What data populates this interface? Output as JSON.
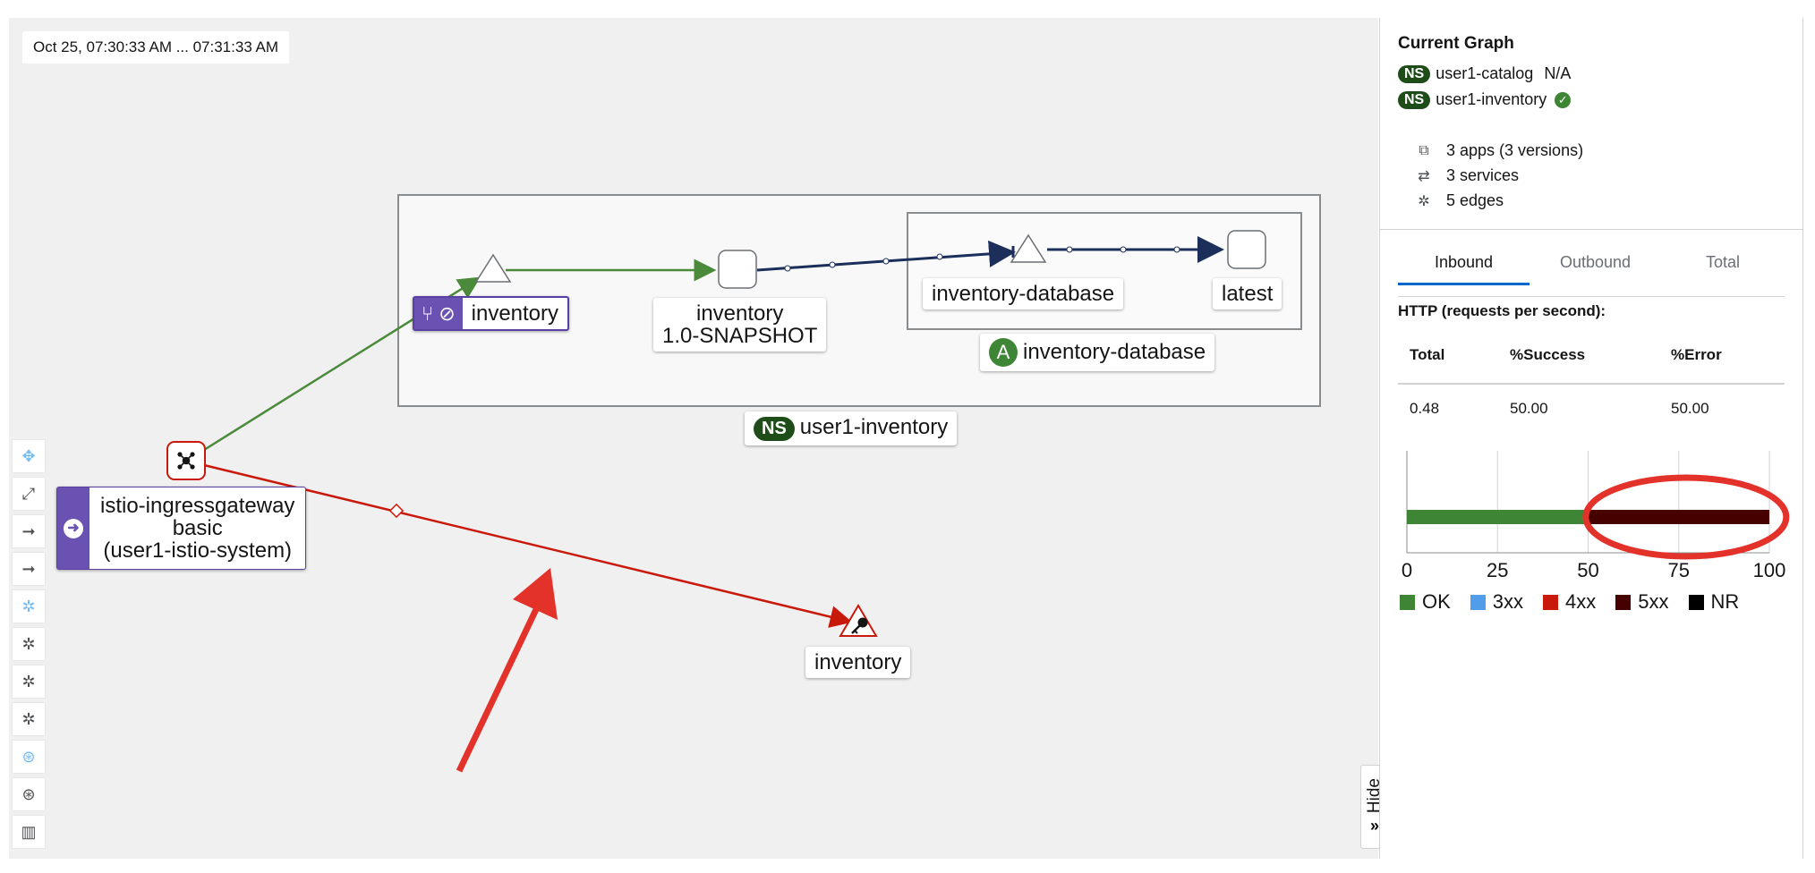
{
  "time_range": "Oct 25, 07:30:33 AM ... 07:31:33 AM",
  "graph": {
    "namespace_box_label": "user1-inventory",
    "ns_badge": "NS",
    "app_box_badge": "A",
    "app_box_label": "inventory-database",
    "nodes": {
      "inventory_app": "inventory",
      "inventory_workload_name": "inventory",
      "inventory_workload_version": "1.0-SNAPSHOT",
      "inventory_database": "inventory-database",
      "latest": "latest",
      "gateway_line1": "istio-ingressgateway",
      "gateway_line2": "basic",
      "gateway_line3": "(user1-istio-system)",
      "inventory_service": "inventory"
    },
    "edge_colors": {
      "healthy": "#4b8a3a",
      "error": "#c9190b",
      "tcp": "#1b2f5a"
    }
  },
  "toolbar": [
    "pan-icon",
    "fit-icon",
    "layout-arrow-icon",
    "layout-arrow-icon-2",
    "layout-cose-icon",
    "layout-dagre-icon",
    "layout-cola-icon",
    "layout-grid-icon",
    "namespace-layout-icon",
    "namespace-layout-icon-2",
    "legend-map-icon"
  ],
  "hide_label": "Hide",
  "panel": {
    "title": "Current Graph",
    "namespaces": [
      {
        "badge": "NS",
        "name": "user1-catalog",
        "status": "N/A"
      },
      {
        "badge": "NS",
        "name": "user1-inventory",
        "status": "healthy"
      }
    ],
    "stats": {
      "apps": "3 apps (3 versions)",
      "services": "3 services",
      "edges": "5 edges"
    },
    "tabs": [
      "Inbound",
      "Outbound",
      "Total"
    ],
    "active_tab": "Inbound",
    "http_title": "HTTP (requests per second):",
    "table": {
      "headers": [
        "Total",
        "%Success",
        "%Error"
      ],
      "values": [
        "0.48",
        "50.00",
        "50.00"
      ]
    }
  },
  "chart_data": {
    "type": "bar",
    "orientation": "horizontal",
    "stacked": true,
    "categories": [
      ""
    ],
    "series": [
      {
        "name": "OK",
        "values": [
          50
        ],
        "color": "#3e8635"
      },
      {
        "name": "3xx",
        "values": [
          0
        ],
        "color": "#519de9"
      },
      {
        "name": "4xx",
        "values": [
          0
        ],
        "color": "#c9190b"
      },
      {
        "name": "5xx",
        "values": [
          50
        ],
        "color": "#470000"
      },
      {
        "name": "NR",
        "values": [
          0
        ],
        "color": "#000000"
      }
    ],
    "xlim": [
      0,
      100
    ],
    "xticks": [
      "0",
      "25",
      "50",
      "75",
      "100"
    ],
    "grid": true,
    "legend": "bottom"
  }
}
